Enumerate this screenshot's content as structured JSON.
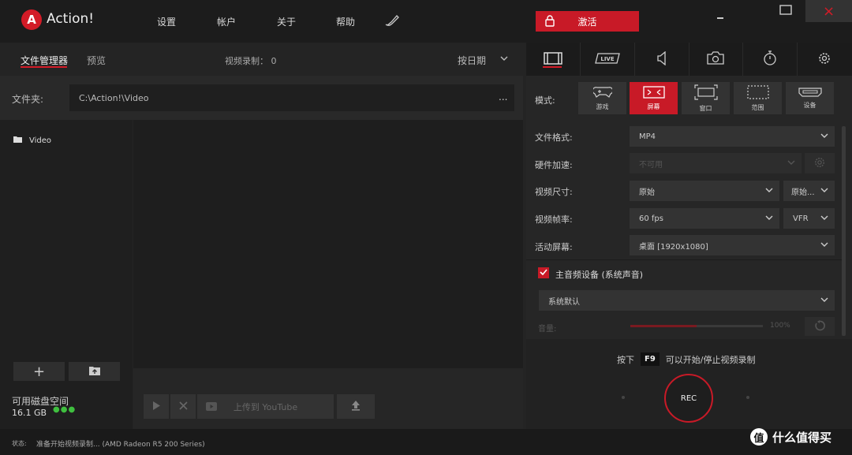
{
  "app": {
    "title": "Action!",
    "logo_letter": "A"
  },
  "menu": [
    "设置",
    "帐户",
    "关于",
    "帮助"
  ],
  "activate_label": "激活",
  "window_controls": {
    "close": "×"
  },
  "left": {
    "tabs": [
      "文件管理器",
      "预览"
    ],
    "recording_count": "视频录制： 0",
    "sort": "按日期",
    "folder_label": "文件夹:",
    "folder_path": "C:\\Action!\\Video",
    "folder_more": "...",
    "tree": [
      "Video"
    ],
    "disk_label": "可用磁盘空间",
    "disk_size": "16.1 GB",
    "add": "+",
    "upload_label": "上传到 YouTube"
  },
  "right": {
    "mode_label": "模式:",
    "modes": [
      "游戏",
      "屏幕",
      "窗口",
      "范围",
      "设备"
    ],
    "active_mode": 1,
    "fields": {
      "format_label": "文件格式:",
      "format_value": "MP4",
      "hwaccel_label": "硬件加速:",
      "hwaccel_value": "不可用",
      "size_label": "视频尺寸:",
      "size_value": "原始",
      "size_value2": "原始...",
      "fps_label": "视频帧率:",
      "fps_value": "60 fps",
      "fps_mode": "VFR",
      "screen_label": "活动屏幕:",
      "screen_value": "桌面 [1920x1080]"
    },
    "audio": {
      "main_label": "主音频设备 (系统声音)",
      "device_value": "系统默认",
      "volume_label": "音量:",
      "volume_pct": "100%",
      "volume_fraction": 0.5
    },
    "hotkey_prefix": "按下",
    "hotkey_key": "F9",
    "hotkey_suffix": "可以开始/停止视频录制",
    "rec_label": "REC"
  },
  "status": {
    "label": "状态:",
    "text": "准备开始视频录制... (AMD Radeon R5 200 Series)"
  },
  "watermark": {
    "icon": "值",
    "text": "什么值得买"
  },
  "colors": {
    "accent": "#c81a27",
    "bg": "#242424",
    "disk_ok": "#3fbf3f"
  }
}
